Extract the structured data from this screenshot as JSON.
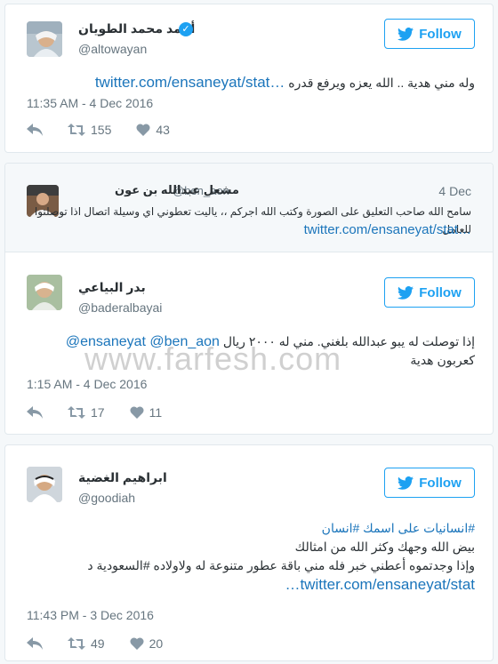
{
  "follow_label": "Follow",
  "colors": {
    "accent": "#1da1f2",
    "link": "#1b75bb",
    "muted": "#66757f"
  },
  "tweets": [
    {
      "author_name": "أحمد محمد الطويان",
      "handle": "@altowayan",
      "verified": true,
      "text": "وله مني هدية .. الله يعزه ويرفع قدره",
      "link": "twitter.com/ensaneyat/stat…",
      "timestamp": "11:35 AM - 4 Dec 2016",
      "retweets": "155",
      "likes": "43"
    },
    {
      "quoted": {
        "author_name": "مشعل عبدالله بن عون",
        "handle": "@ben_aon",
        "date": "4 Dec",
        "text": "سامح الله صاحب التعليق على الصورة وكتب الله اجركم ،، ياليت تعطوني اي وسيلة اتصال اذا توصلتوا للعامل",
        "link": "twitter.com/ensaneyat/stat…"
      },
      "author_name": "بدر البياعي",
      "handle": "@baderalbayai",
      "text_mentions": "@ensaneyat @ben_aon",
      "text_line1": "إذا توصلت له يبو عبدالله بلغني. مني له ٢٠٠٠ ريال",
      "text_line2": "كعربون هدية",
      "timestamp": "1:15 AM - 4 Dec 2016",
      "retweets": "17",
      "likes": "11"
    },
    {
      "author_name": "ابراهيم الغضية",
      "handle": "@goodiah",
      "hashtags": "#انسانيات على اسمك #انسان",
      "text_line1": "بيض الله وجهك وكثر الله من امثالك",
      "text_line2": "وإذا وجدتموه أعطني خبر فله مني باقة عطور متنوعة له ولاولاده #السعودية د",
      "link": "twitter.com/ensaneyat/stat…",
      "timestamp": "11:43 PM - 3 Dec 2016",
      "retweets": "49",
      "likes": "20"
    }
  ],
  "watermark": "www.farfesh.com"
}
